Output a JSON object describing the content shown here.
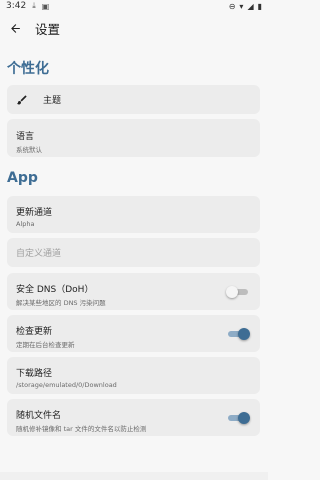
{
  "status_bar": {
    "time": "3:42"
  },
  "app_bar": {
    "title": "设置"
  },
  "personalization": {
    "section_title": "个性化",
    "theme": {
      "label": "主题",
      "icon": "brush-icon"
    },
    "language": {
      "title": "语言",
      "subtitle": "系统默认"
    }
  },
  "app": {
    "section_title": "App",
    "update_channel": {
      "title": "更新通道",
      "subtitle": "Alpha"
    },
    "custom_channel": {
      "placeholder": "自定义通道"
    },
    "secure_dns": {
      "title": "安全 DNS（DoH）",
      "subtitle": "解决某些地区的 DNS 污染问题",
      "enabled": false
    },
    "check_updates": {
      "title": "检查更新",
      "subtitle": "定期在后台检查更新",
      "enabled": true
    },
    "download_path": {
      "title": "下载路径",
      "subtitle": "/storage/emulated/0/Download"
    },
    "random_filename": {
      "title": "随机文件名",
      "subtitle": "随机修补镜像和 tar 文件的文件名以防止检测",
      "enabled": true
    }
  },
  "colors": {
    "accent": "#3e6d94",
    "card": "#ececec",
    "background": "#f7f7f7"
  }
}
